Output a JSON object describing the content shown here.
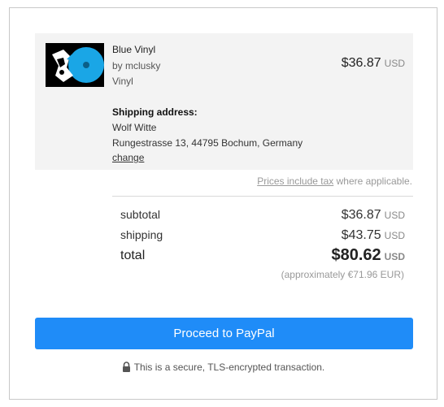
{
  "item": {
    "title": "Blue Vinyl",
    "artist": "by mclusky",
    "format": "Vinyl",
    "price": "$36.87",
    "currency": "USD",
    "cover_colors": {
      "background": "#000000",
      "vinyl": "#1aa6e6",
      "sleeve_art": "#ffffff"
    }
  },
  "shipping": {
    "label": "Shipping address:",
    "name": "Wolf Witte",
    "address": "Rungestrasse 13, 44795 Bochum, Germany",
    "change_label": "change"
  },
  "tax_note": {
    "link": "Prices include tax",
    "text": " where applicable."
  },
  "summary": {
    "subtotal_label": "subtotal",
    "subtotal_value": "$36.87",
    "shipping_label": "shipping",
    "shipping_value": "$43.75",
    "total_label": "total",
    "total_value": "$80.62",
    "currency": "USD",
    "approx": "(approximately €71.96 EUR)"
  },
  "actions": {
    "paypal_label": "Proceed to PayPal",
    "paypal_color": "#1f8cf8"
  },
  "security": {
    "icon": "lock-icon",
    "text": "This is a secure, TLS-encrypted transaction."
  }
}
